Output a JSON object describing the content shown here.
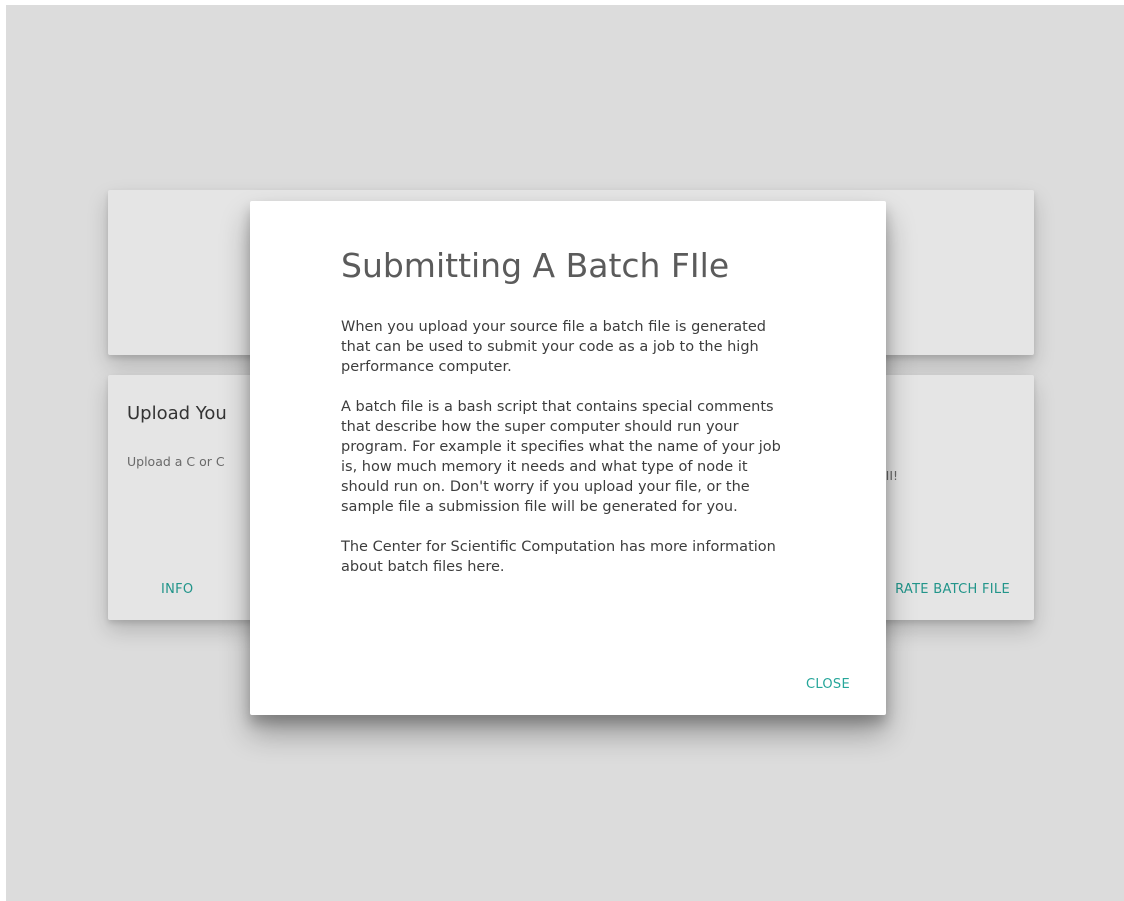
{
  "background_cards": {
    "upload_card": {
      "title": "Upload You",
      "description": "Upload a C or C",
      "description_right": "e II!",
      "info_label": "INFO",
      "generate_label": "RATE BATCH FILE"
    }
  },
  "modal": {
    "title": "Submitting A Batch FIle",
    "paragraphs": [
      "When you upload your source file a batch file is generated that can be used to submit your code as a job to the high performance computer.",
      "A batch file is a bash script that contains special comments that describe how the super computer should run your program. For example it specifies what the name of your job is, how much memory it needs and what type of node it should run on. Don't worry if you upload your file, or the sample file a submission file will be generated for you.",
      "The Center for Scientific Computation has more information about batch files here."
    ],
    "close_label": "CLOSE"
  },
  "colors": {
    "accent": "#26a69a",
    "overlay": "rgba(0,0,0,0.10)",
    "card_background": "#ffffff"
  }
}
